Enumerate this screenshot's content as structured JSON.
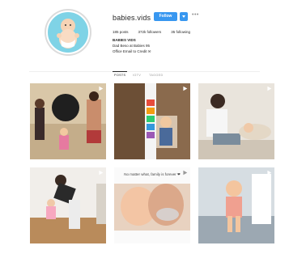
{
  "profile": {
    "username": "babies.vids",
    "follow_label": "Follow",
    "stats": {
      "posts": "185 posts",
      "followers": "372k followers",
      "following": "35 following"
    },
    "bio": {
      "name": "BABIES VIDS",
      "line1": "Dad Beso at Babies 95",
      "line2": "Office Email to Credit ✉"
    }
  },
  "tabs": [
    {
      "label": "POSTS"
    },
    {
      "label": "IGTV"
    },
    {
      "label": "TAGGED"
    }
  ],
  "posts": [
    {
      "id": "p1",
      "type": "video"
    },
    {
      "id": "p2",
      "type": "video"
    },
    {
      "id": "p3",
      "type": "video"
    },
    {
      "id": "p4",
      "type": "video"
    },
    {
      "id": "p5",
      "type": "video",
      "caption": "No matter what, family is forever ❤"
    },
    {
      "id": "p6",
      "type": "video"
    }
  ],
  "colors": {
    "accent": "#3897f0",
    "avatar_bg": "#7fd3e6"
  }
}
